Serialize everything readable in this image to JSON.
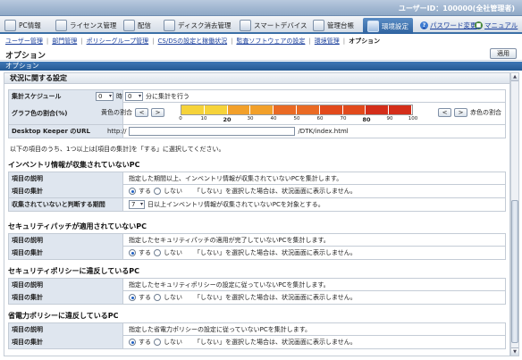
{
  "header": {
    "user_label": "ユーザーID：100000(全社管理者)"
  },
  "menu": {
    "items": [
      {
        "label": "PC情報"
      },
      {
        "label": "ライセンス管理"
      },
      {
        "label": "配信"
      },
      {
        "label": "ディスク消去管理"
      },
      {
        "label": "スマートデバイス"
      },
      {
        "label": "管理台帳"
      },
      {
        "label": "環境設定"
      }
    ],
    "links": [
      {
        "label": "パスワード変更"
      },
      {
        "label": "マニュアル"
      }
    ]
  },
  "subnav": {
    "items": [
      "ユーザー管理",
      "部門管理",
      "ポリシーグループ管理",
      "CS/DSの設定と稼働状況",
      "監査ソフトウェアの設定",
      "環境管理",
      "オプション"
    ]
  },
  "page": {
    "title": "オプション",
    "apply_label": "適用",
    "section_bar": "オプション"
  },
  "status_settings": {
    "title": "状況に関する設定",
    "schedule": {
      "label": "集計スケジュール",
      "hour_value": "0",
      "hour_unit": "時",
      "minute_value": "0",
      "minute_suffix": "分に集計を行う"
    },
    "graph": {
      "label": "グラフ色の割合(%)",
      "left_text": "黄色の割合",
      "left_btn_prev": "<",
      "left_btn_next": ">",
      "right_text": "赤色の割合",
      "right_btn_prev": "<",
      "right_btn_next": ">",
      "colors": [
        "#f6d33a",
        "#f6d33a",
        "#f2a02a",
        "#f2a02a",
        "#ea6a24",
        "#ea6a24",
        "#e24a1c",
        "#e24a1c",
        "#d42e1a",
        "#d42e1a"
      ],
      "ticks": [
        "0",
        "10",
        "20",
        "30",
        "40",
        "50",
        "60",
        "70",
        "80",
        "90",
        "100"
      ],
      "bold_ticks": [
        "20",
        "80"
      ],
      "yellow_percent": 20,
      "red_percent": 80
    },
    "dk_url": {
      "label": "Desktop Keeper のURL",
      "prefix": "http://",
      "value": "",
      "suffix": "/DTK/index.html"
    },
    "instruction": "以下の項目のうち、1つ以上は[項目の集計]を「する」に選択してください。"
  },
  "sections": [
    {
      "title": "インベントリ情報が収集されていないPC",
      "desc_label": "項目の説明",
      "desc": "指定した期間以上、インベントリ情報が収集されていないPCを集計します。",
      "agg_label": "項目の集計",
      "on": "する",
      "off": "しない",
      "agg_note": "「しない」を選択した場合は、状況画面に表示しません。",
      "period_label": "収集されていないと判断する期間",
      "period_value": "7",
      "period_suffix": "日以上インベントリ情報が収集されていないPCを対象とする。"
    },
    {
      "title": "セキュリティパッチが適用されていないPC",
      "desc_label": "項目の説明",
      "desc": "指定したセキュリティパッチの適用が完了していないPCを集計します。",
      "agg_label": "項目の集計",
      "on": "する",
      "off": "しない",
      "agg_note": "「しない」を選択した場合は、状況画面に表示しません。"
    },
    {
      "title": "セキュリティポリシーに違反しているPC",
      "desc_label": "項目の説明",
      "desc": "指定したセキュリティポリシーの設定に従っていないPCを集計します。",
      "agg_label": "項目の集計",
      "on": "する",
      "off": "しない",
      "agg_note": "「しない」を選択した場合は、状況画面に表示しません。"
    },
    {
      "title": "省電力ポリシーに違反しているPC",
      "desc_label": "項目の説明",
      "desc": "指定した省電力ポリシーの設定に従っていないPCを集計します。",
      "agg_label": "項目の集計",
      "on": "する",
      "off": "しない",
      "agg_note": "「しない」を選択した場合は、状況画面に表示しません。"
    }
  ]
}
